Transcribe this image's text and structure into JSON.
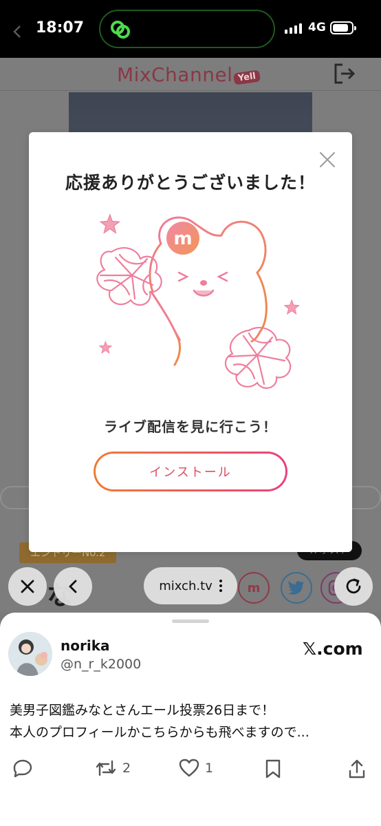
{
  "status_bar": {
    "time": "18:07",
    "network": "4G"
  },
  "background_page": {
    "logo_text": "MixChannel",
    "logo_badge": "Yell",
    "entry_badge": "エントリーNo.2",
    "post_badge": "X ポスト",
    "heading": "な"
  },
  "modal": {
    "title": "応援ありがとうございました！",
    "subtitle": "ライブ配信を見に行こう！",
    "install_label": "インストール",
    "mascot_letter": "m"
  },
  "browser": {
    "url": "mixch.tv"
  },
  "tweet": {
    "display_name": "norika",
    "handle": "@n_r_k2000",
    "source": "𝕏.com",
    "text_line1": "美男子図鑑みなとさんエール投票26日まで！",
    "text_line2": "本人のプロフィールかこちらからも飛べますので...",
    "retweet_count": "2",
    "like_count": "1"
  },
  "colors": {
    "brand_gradient_start": "#ef7b33",
    "brand_gradient_end": "#e9407f",
    "mixchannel_red": "#d9364f",
    "twitter_blue": "#1d9bf0"
  },
  "icons": [
    "back-icon",
    "close-icon",
    "chevron-left-icon",
    "reload-icon",
    "more-icon",
    "logout-icon",
    "reply-icon",
    "retweet-icon",
    "like-icon",
    "bookmark-icon",
    "share-icon"
  ]
}
